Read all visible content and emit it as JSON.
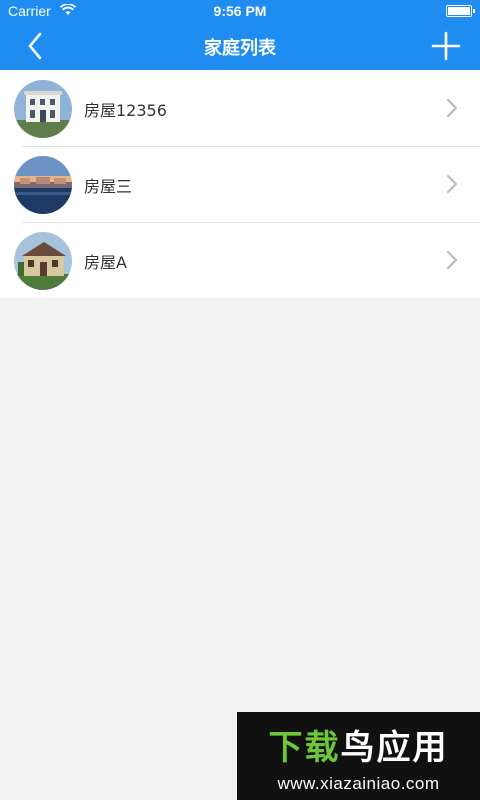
{
  "status_bar": {
    "carrier": "Carrier",
    "time": "9:56 PM"
  },
  "nav": {
    "title": "家庭列表"
  },
  "houses": [
    {
      "name": "房屋12356"
    },
    {
      "name": "房屋三"
    },
    {
      "name": "房屋A"
    }
  ],
  "watermark": {
    "text_part1": "下载",
    "text_part2": "鸟应用",
    "url": "www.xiazainiao.com"
  },
  "colors": {
    "accent": "#1e8cf0",
    "background": "#f2f2f2"
  }
}
